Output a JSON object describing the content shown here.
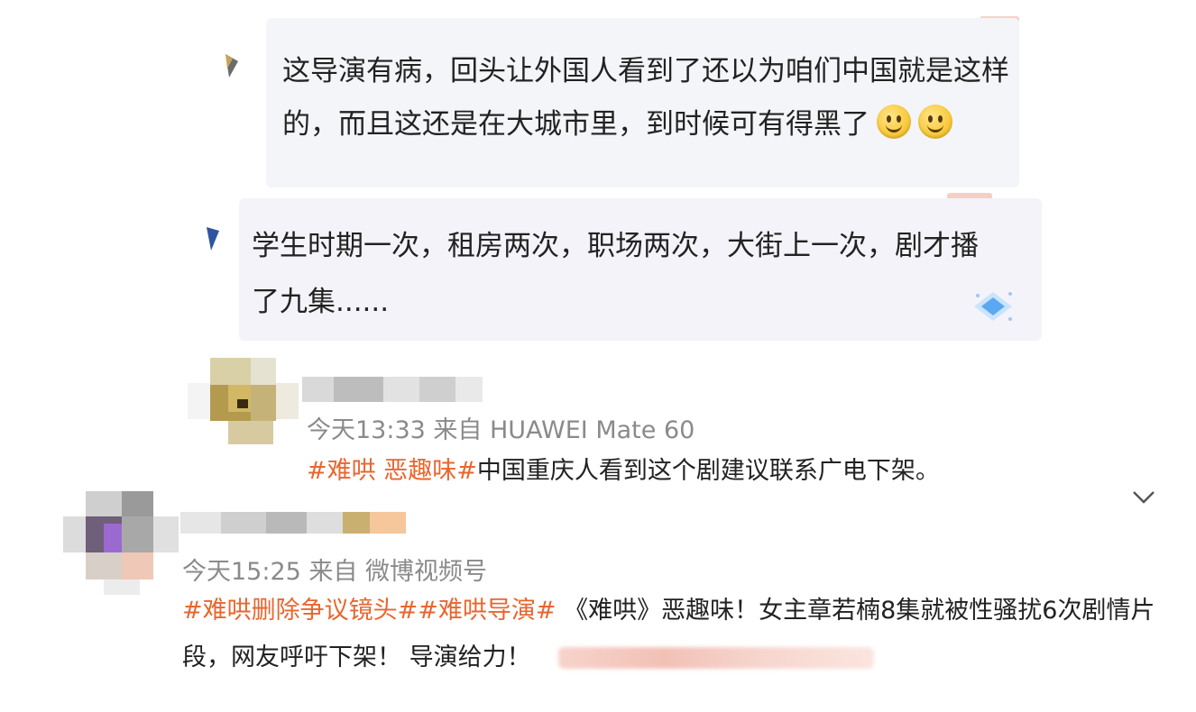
{
  "quote1": {
    "text": "这导演有病，回头让外国人看到了还以为咱们中国就是这样的，而且这还是在大城市里，到时候可有得黑了",
    "emoji_count": 2,
    "emoji_icon": "slight-smile-icon"
  },
  "quote2": {
    "text": "学生时期一次，租房两次，职场两次，大街上一次，剧才播了九集......"
  },
  "comment1": {
    "meta": "今天13:33  来自 HUAWEI Mate 60",
    "tag": "#难哄 恶趣味#",
    "text": "中国重庆人看到这个剧建议联系广电下架。"
  },
  "comment2": {
    "meta": "今天15:25  来自 微博视频号",
    "tags": "#难哄删除争议镜头##难哄导演#",
    "text": " 《难哄》恶趣味！女主章若楠8集就被性骚扰6次剧情片段，网友呼吁下架！ 导演给力！"
  },
  "colors": {
    "tag": "#e8662f",
    "meta": "#8a8a8a",
    "card_bg": "#f4f5f8"
  }
}
